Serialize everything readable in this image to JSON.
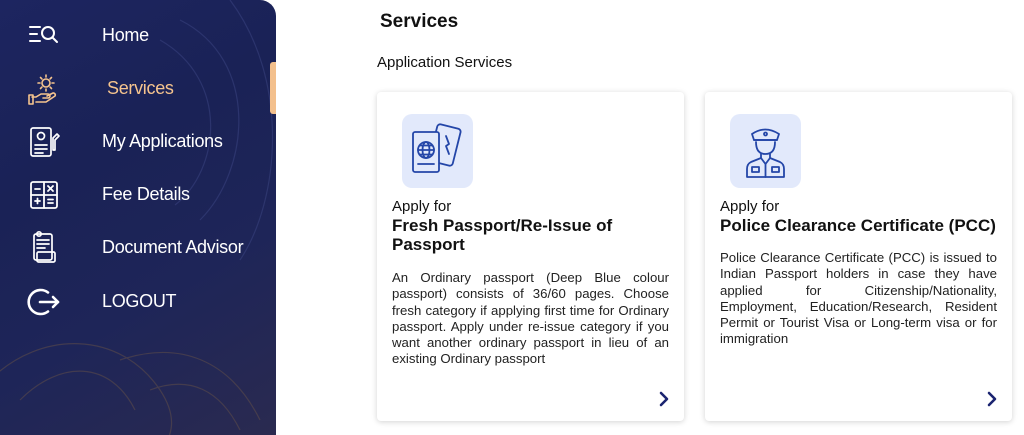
{
  "sidebar": {
    "items": [
      {
        "label": "Home",
        "icon": "home-search-icon"
      },
      {
        "label": "Services",
        "icon": "services-hand-gear-icon"
      },
      {
        "label": "My Applications",
        "icon": "applications-document-icon"
      },
      {
        "label": "Fee Details",
        "icon": "calculator-icon"
      },
      {
        "label": "Document Advisor",
        "icon": "document-advisor-icon"
      },
      {
        "label": "LOGOUT",
        "icon": "logout-icon"
      }
    ],
    "active_item": "Services",
    "colors": {
      "background": "#1d2560",
      "active": "#f6c48e"
    }
  },
  "main": {
    "title": "Services",
    "section_title": "Application Services",
    "cards": [
      {
        "apply_label": "Apply for",
        "title": "Fresh Passport/Re-Issue of Passport",
        "description": "An Ordinary passport (Deep Blue colour passport) consists of 36/60 pages. Choose fresh category if applying first time for Ordinary passport. Apply under re-issue category if you want another ordinary passport in lieu of an existing Ordinary passport",
        "icon": "passport-icon"
      },
      {
        "apply_label": "Apply for",
        "title": "Police Clearance Certificate (PCC)",
        "description": "Police Clearance Certificate (PCC) is issued to Indian Passport holders in case they have applied for Citizenship/Nationality, Employment, Education/Research, Resident Permit or Tourist Visa or Long-term visa or for immigration",
        "icon": "police-officer-icon"
      }
    ]
  }
}
